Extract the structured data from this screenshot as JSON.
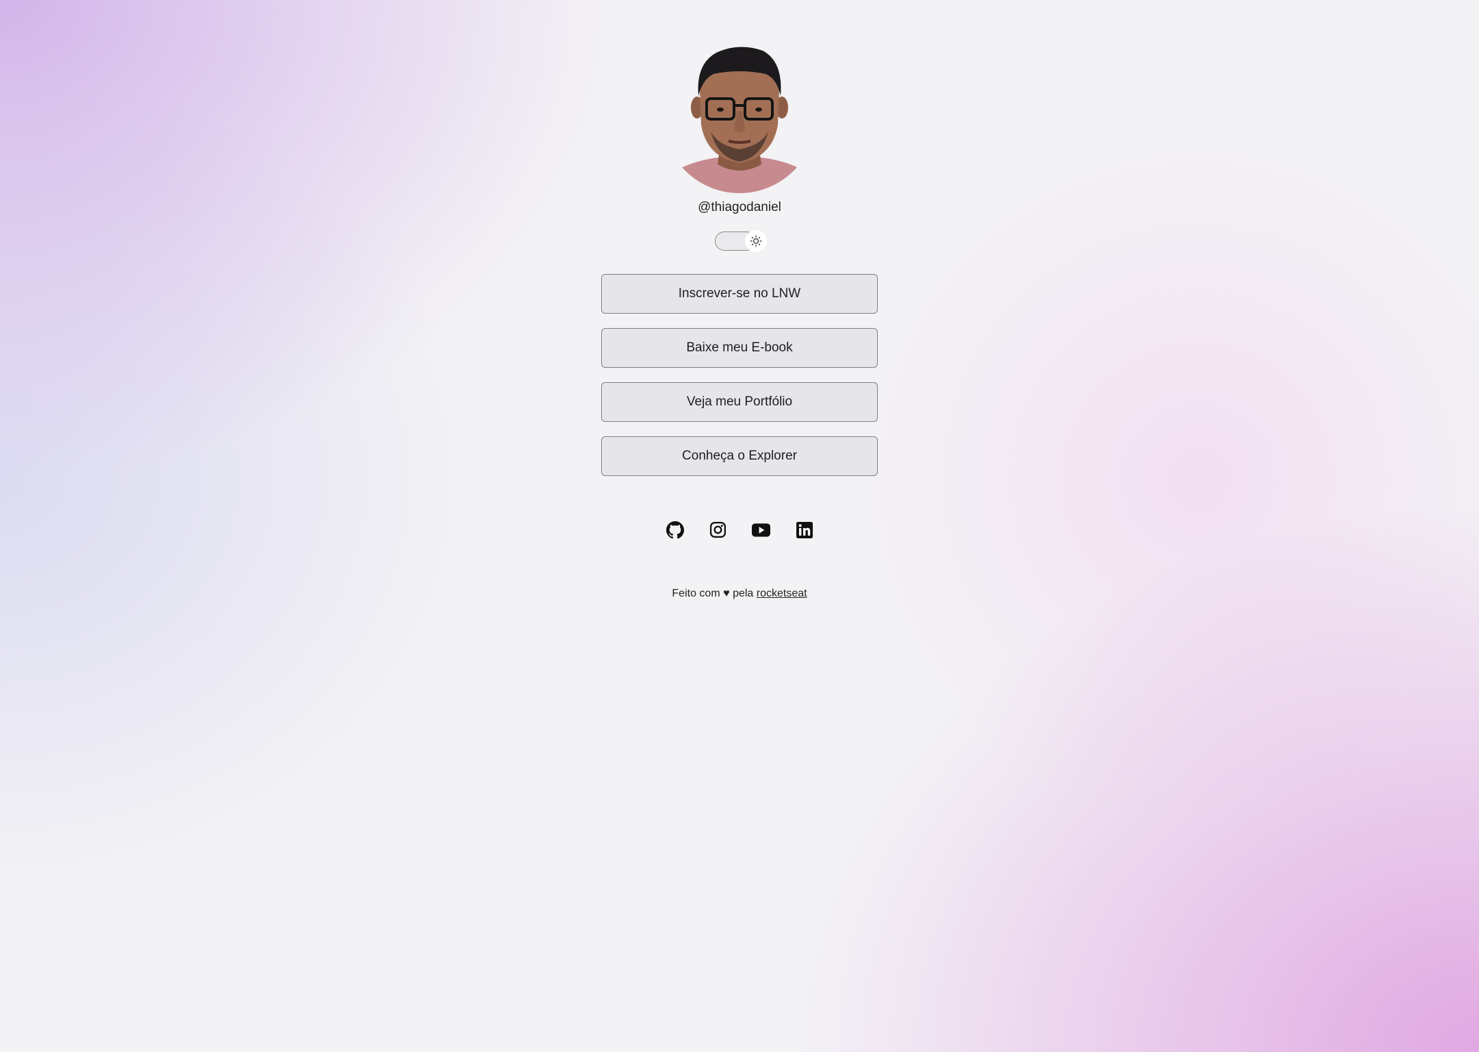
{
  "profile": {
    "handle": "@thiagodaniel",
    "avatar_alt": "Foto de perfil"
  },
  "theme_toggle": {
    "icon": "sun-icon",
    "state": "light"
  },
  "links": [
    {
      "label": "Inscrever-se no LNW"
    },
    {
      "label": "Baixe meu E-book"
    },
    {
      "label": "Veja meu Portfólio"
    },
    {
      "label": "Conheça o Explorer"
    }
  ],
  "social": [
    {
      "icon": "github-icon"
    },
    {
      "icon": "instagram-icon"
    },
    {
      "icon": "youtube-icon"
    },
    {
      "icon": "linkedin-icon"
    }
  ],
  "footer": {
    "prefix": "Feito com",
    "heart": "♥",
    "middle": "pela",
    "link_text": "rocketseat"
  },
  "colors": {
    "text": "#222222",
    "button_border": "#7f7f85",
    "button_bg": "#e1e0e4",
    "accent_gradient_a": "#cdaae8",
    "accent_gradient_b": "#dea0e0"
  }
}
